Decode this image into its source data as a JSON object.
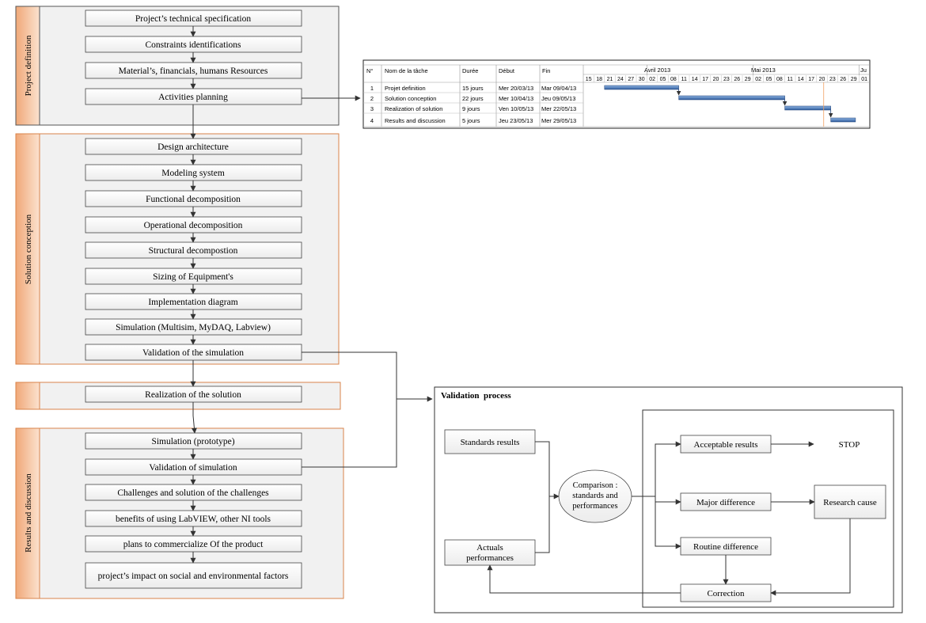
{
  "phases": [
    {
      "id": "definition",
      "label": "Project definition",
      "steps": [
        "Project’s technical specification",
        "Constraints identifications",
        "Material’s, financials, humans Resources",
        "Activities planning"
      ]
    },
    {
      "id": "conception",
      "label": "Solution conception",
      "steps": [
        "Design architecture",
        "Modeling system",
        "Functional decomposition",
        "Operational decomposition",
        "Structural decompostion",
        "Sizing of Equipment's",
        "Implementation diagram",
        "Simulation (Multisim, MyDAQ, Labview)",
        "Validation of the simulation"
      ]
    },
    {
      "id": "realization",
      "label": "",
      "steps": [
        "Realization of the solution"
      ]
    },
    {
      "id": "results",
      "label": "Results and discussion",
      "steps": [
        "Simulation (prototype)",
        "Validation of simulation",
        "Challenges and solution of the challenges",
        "benefits of using LabVIEW, other NI tools",
        "plans to commercialize Of the product",
        "project’s impact on social and environmental factors"
      ]
    }
  ],
  "gantt": {
    "headers": {
      "num": "N°",
      "name": "Nom de la tâche",
      "duration": "Durée",
      "start": "Début",
      "end": "Fin"
    },
    "months": [
      "Avril 2013",
      "Mai 2013",
      "Ju"
    ],
    "days": [
      "15",
      "18",
      "21",
      "24",
      "27",
      "30",
      "02",
      "05",
      "08",
      "11",
      "14",
      "17",
      "20",
      "23",
      "26",
      "29",
      "02",
      "05",
      "08",
      "11",
      "14",
      "17",
      "20",
      "23",
      "26",
      "29",
      "01"
    ],
    "tasks": [
      {
        "num": "1",
        "name": "Projet definition",
        "duration": "15 jours",
        "start": "Mer 20/03/13",
        "end": "Mar 09/04/13",
        "s": 20,
        "e": 41
      },
      {
        "num": "2",
        "name": "Solution conception",
        "duration": "22 jours",
        "start": "Mer 10/04/13",
        "end": "Jeu 09/05/13",
        "s": 41,
        "e": 71
      },
      {
        "num": "3",
        "name": "Realization of solution",
        "duration": "9 jours",
        "start": "Ven 10/05/13",
        "end": "Mer 22/05/13",
        "s": 71,
        "e": 84
      },
      {
        "num": "4",
        "name": "Results and discussion",
        "duration": "5 jours",
        "start": "Jeu 23/05/13",
        "end": "Mer 29/05/13",
        "s": 84,
        "e": 91
      }
    ]
  },
  "validation": {
    "title": "Validation  process",
    "standards": "Standards results",
    "actuals": [
      "Actuals",
      "performances"
    ],
    "comparison": [
      "Comparison :",
      "standards and",
      "performances"
    ],
    "acceptable": "Acceptable results",
    "stop": "STOP",
    "major": "Major difference",
    "research": "Research cause",
    "routine": "Routine difference",
    "correction": "Correction"
  }
}
